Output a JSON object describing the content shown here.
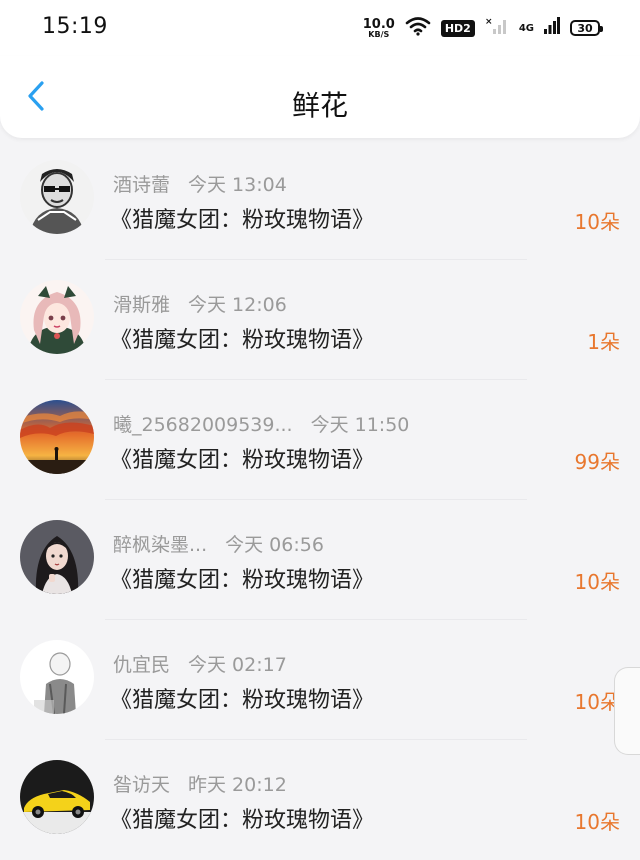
{
  "status_bar": {
    "time": "15:19",
    "net_speed_value": "10.0",
    "net_speed_unit": "KB/S",
    "hd_badge": "HD2",
    "network_label": "4G",
    "battery": "30"
  },
  "nav": {
    "title": "鲜花",
    "back_icon": "chevron-left-icon",
    "accent_color": "#2aa0f0"
  },
  "colors": {
    "count": "#e8772e",
    "meta": "#9a9a9a"
  },
  "rows": [
    {
      "name": "酒诗蕾",
      "time": "今天 13:04",
      "book": "《猎魔女团：粉玫瑰物语》",
      "count": "10朵",
      "avatar": "comic-man-avatar"
    },
    {
      "name": "滑斯雅",
      "time": "今天 12:06",
      "book": "《猎魔女团：粉玫瑰物语》",
      "count": "1朵",
      "avatar": "anime-girl-avatar"
    },
    {
      "name": "曦_25682009539...",
      "time": "今天 11:50",
      "book": "《猎魔女团：粉玫瑰物语》",
      "count": "99朵",
      "avatar": "sunset-sky-avatar"
    },
    {
      "name": "醉枫染墨...",
      "time": "今天 06:56",
      "book": "《猎魔女团：粉玫瑰物语》",
      "count": "10朵",
      "avatar": "dark-hair-girl-avatar"
    },
    {
      "name": "仇宜民",
      "time": "今天 02:17",
      "book": "《猎魔女团：粉玫瑰物语》",
      "count": "10朵",
      "avatar": "sketch-figure-avatar"
    },
    {
      "name": "昝访天",
      "time": "昨天 20:12",
      "book": "《猎魔女团：粉玫瑰物语》",
      "count": "10朵",
      "avatar": "yellow-car-avatar"
    }
  ]
}
